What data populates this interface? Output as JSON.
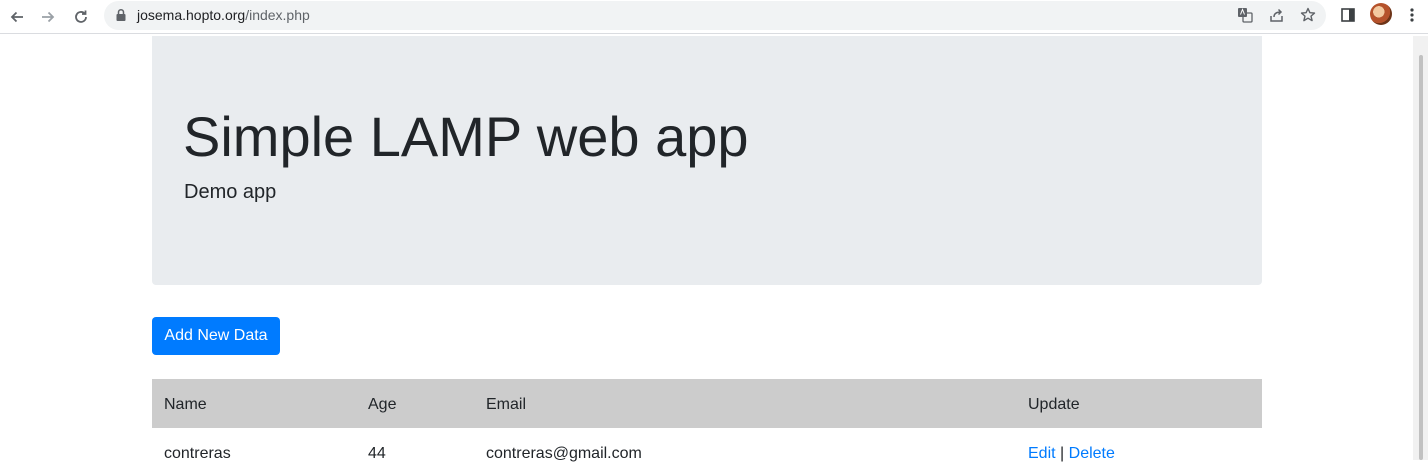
{
  "browser": {
    "url_host": "josema.hopto.org",
    "url_path": "/index.php"
  },
  "page": {
    "title": "Simple LAMP web app",
    "subtitle": "Demo app",
    "add_button_label": "Add New Data"
  },
  "table": {
    "headers": [
      "Name",
      "Age",
      "Email",
      "Update"
    ],
    "rows": [
      {
        "name": "contreras",
        "age": "44",
        "email": "contreras@gmail.com",
        "edit": "Edit",
        "separator": "|",
        "delete": "Delete"
      }
    ]
  },
  "colors": {
    "primary": "#007bff",
    "jumbotron_bg": "#e9ecef",
    "table_header_bg": "#cccccc"
  }
}
